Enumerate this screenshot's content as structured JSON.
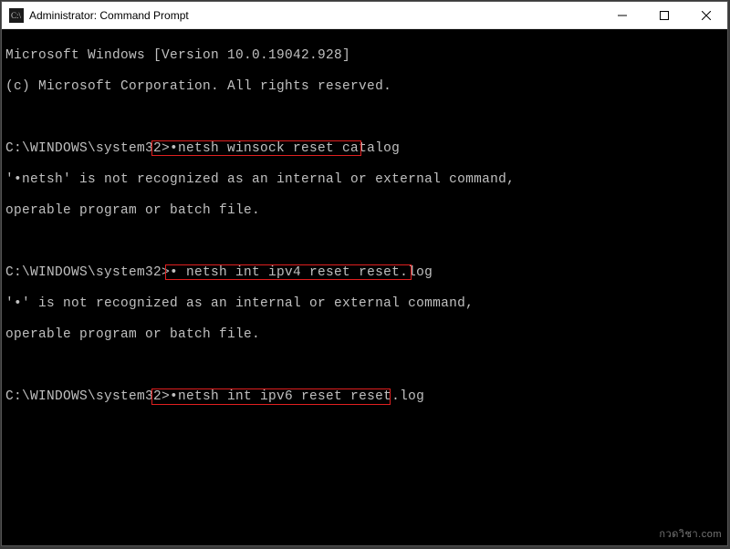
{
  "window": {
    "title": "Administrator: Command Prompt"
  },
  "highlight_color": "#e02020",
  "terminal": {
    "version_line": "Microsoft Windows [Version 10.0.19042.928]",
    "copyright_line": "(c) Microsoft Corporation. All rights reserved.",
    "prompt1": "C:\\WINDOWS\\system32>",
    "cmd1": "•netsh winsock reset catalog",
    "err1a": "'•netsh' is not recognized as an internal or external command,",
    "err1b": "operable program or batch file.",
    "prompt2": "C:\\WINDOWS\\system32>",
    "cmd2": "• netsh int ipv4 reset reset.log",
    "err2a": "'•' is not recognized as an internal or external command,",
    "err2b": "operable program or batch file.",
    "prompt3": "C:\\WINDOWS\\system32>",
    "cmd3": "•netsh int ipv6 reset reset.log"
  },
  "watermark": "กวดวิชา.com"
}
